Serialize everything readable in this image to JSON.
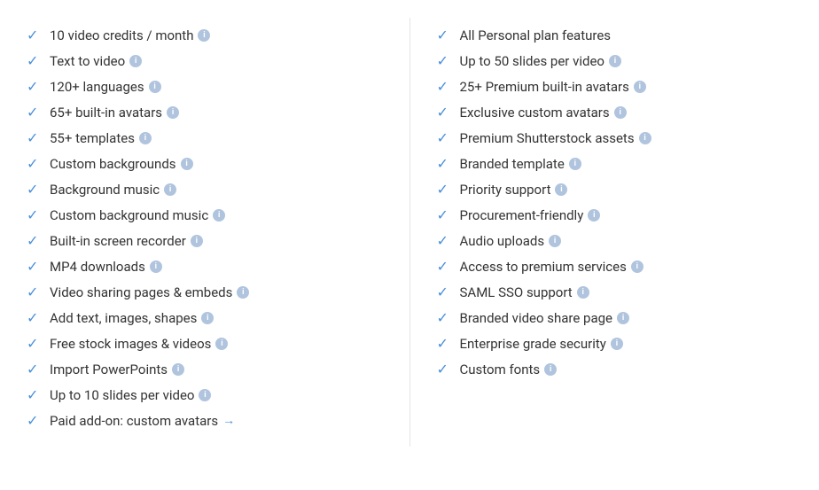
{
  "left_column": {
    "items": [
      {
        "label": "10 video credits / month",
        "has_info": true,
        "has_arrow": false
      },
      {
        "label": "Text to video",
        "has_info": true,
        "has_arrow": false
      },
      {
        "label": "120+ languages",
        "has_info": true,
        "has_arrow": false
      },
      {
        "label": "65+ built-in avatars",
        "has_info": true,
        "has_arrow": false
      },
      {
        "label": "55+ templates",
        "has_info": true,
        "has_arrow": false
      },
      {
        "label": "Custom backgrounds",
        "has_info": true,
        "has_arrow": false
      },
      {
        "label": "Background music",
        "has_info": true,
        "has_arrow": false
      },
      {
        "label": "Custom background music",
        "has_info": true,
        "has_arrow": false
      },
      {
        "label": "Built-in screen recorder",
        "has_info": true,
        "has_arrow": false
      },
      {
        "label": "MP4 downloads",
        "has_info": true,
        "has_arrow": false
      },
      {
        "label": "Video sharing pages & embeds",
        "has_info": true,
        "has_arrow": false
      },
      {
        "label": "Add text, images, shapes",
        "has_info": true,
        "has_arrow": false
      },
      {
        "label": "Free stock images & videos",
        "has_info": true,
        "has_arrow": false
      },
      {
        "label": "Import PowerPoints",
        "has_info": true,
        "has_arrow": false
      },
      {
        "label": "Up to 10 slides per video",
        "has_info": true,
        "has_arrow": false
      },
      {
        "label": "Paid add-on: custom avatars",
        "has_info": false,
        "has_arrow": true
      }
    ]
  },
  "right_column": {
    "items": [
      {
        "label": "All Personal plan features",
        "has_info": false,
        "has_arrow": false
      },
      {
        "label": "Up to 50 slides per video",
        "has_info": true,
        "has_arrow": false
      },
      {
        "label": "25+ Premium built-in avatars",
        "has_info": true,
        "has_arrow": false
      },
      {
        "label": "Exclusive custom avatars",
        "has_info": true,
        "has_arrow": false
      },
      {
        "label": "Premium Shutterstock assets",
        "has_info": true,
        "has_arrow": false
      },
      {
        "label": "Branded template",
        "has_info": true,
        "has_arrow": false
      },
      {
        "label": "Priority support",
        "has_info": true,
        "has_arrow": false
      },
      {
        "label": "Procurement-friendly",
        "has_info": true,
        "has_arrow": false
      },
      {
        "label": "Audio uploads",
        "has_info": true,
        "has_arrow": false
      },
      {
        "label": "Access to premium services",
        "has_info": true,
        "has_arrow": false
      },
      {
        "label": "SAML SSO support",
        "has_info": true,
        "has_arrow": false
      },
      {
        "label": "Branded video share page",
        "has_info": true,
        "has_arrow": false
      },
      {
        "label": "Enterprise grade security",
        "has_info": true,
        "has_arrow": false
      },
      {
        "label": "Custom fonts",
        "has_info": true,
        "has_arrow": false
      }
    ]
  },
  "icons": {
    "check": "✓",
    "info": "i",
    "arrow": "→"
  }
}
